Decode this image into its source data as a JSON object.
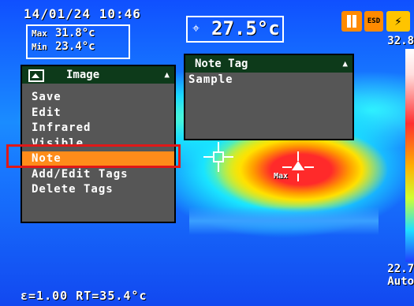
{
  "status": {
    "datetime": "14/01/24 10:46",
    "max_label": "Max",
    "max_value": "31.8°c",
    "min_label": "Min",
    "min_value": "23.4°c",
    "spot_value": "27.5°c",
    "esd_label": "ESD"
  },
  "scale": {
    "top_value": "32.8",
    "bottom_value": "22.7",
    "mode": "Auto"
  },
  "footer": {
    "emissivity": "ε=1.00",
    "reflected_temp": "RT=35.4°c"
  },
  "image_menu": {
    "title": "Image",
    "items": [
      {
        "label": "Save"
      },
      {
        "label": "Edit"
      },
      {
        "label": "Infrared"
      },
      {
        "label": "Visible"
      },
      {
        "label": "Note",
        "selected": true
      },
      {
        "label": "Add/Edit Tags"
      },
      {
        "label": "Delete Tags"
      }
    ]
  },
  "note_tag_menu": {
    "title": "Note Tag",
    "value": "Sample"
  },
  "cursor": {
    "max_label": "Max"
  },
  "colors": {
    "menu_header": "#0d3a1a",
    "menu_bg": "#565656",
    "selection": "#ff8c1a",
    "highlight_box": "#e01818"
  },
  "icons": [
    "spot-target-icon",
    "pause-icon",
    "esd-icon",
    "battery-charge-icon",
    "image-icon",
    "updown-arrow-icon",
    "crosshair-icon",
    "max-cursor-icon"
  ]
}
